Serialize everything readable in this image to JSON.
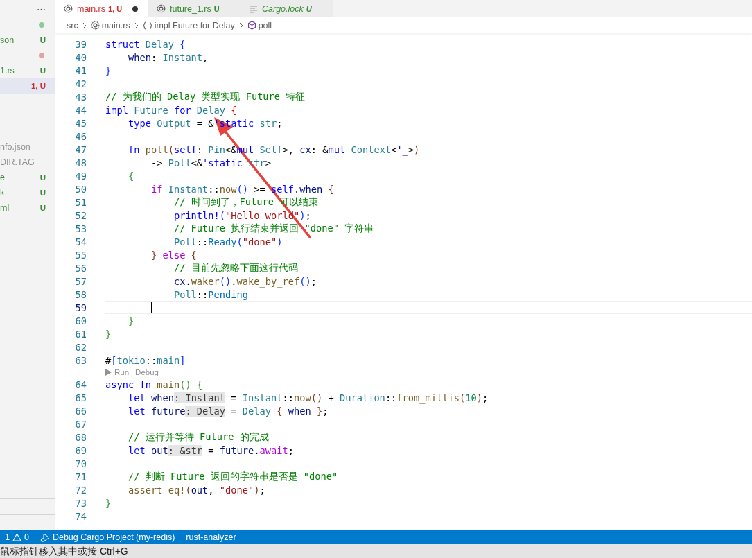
{
  "sidebar": {
    "menu": "···",
    "groups": [
      [
        {
          "kind": "dot",
          "color": "#8fc89a",
          "selected": false
        },
        {
          "kind": "file",
          "label": "son",
          "badge": "U",
          "color": "#388a34",
          "selected": false
        },
        {
          "kind": "dot",
          "color": "#e3a3a3",
          "selected": false
        },
        {
          "kind": "file",
          "label": "1.rs",
          "badge": "U",
          "color": "#388a34",
          "selected": false
        },
        {
          "kind": "file",
          "badge": "1, U",
          "color": "#c72e2e",
          "selected": true
        }
      ],
      [
        {
          "kind": "file",
          "label": "nfo.json",
          "color": "#8e8e90",
          "selected": false
        },
        {
          "kind": "file",
          "label": "DIR.TAG",
          "color": "#8e8e90",
          "selected": false
        },
        {
          "kind": "file",
          "label": "e",
          "badge": "U",
          "color": "#388a34",
          "selected": false
        },
        {
          "kind": "file",
          "label": "k",
          "badge": "U",
          "color": "#388a34",
          "selected": false
        },
        {
          "kind": "file",
          "label": "ml",
          "badge": "U",
          "color": "#388a34",
          "selected": false
        }
      ]
    ]
  },
  "tabs": [
    {
      "kind": "source",
      "label": "main.rs",
      "badge": "1, U",
      "color": "#c72e2e",
      "selected": true,
      "modified": true,
      "preview": false
    },
    {
      "kind": "source",
      "label": "future_1.rs",
      "badge": "U",
      "color": "#388a34",
      "selected": false,
      "modified": false,
      "preview": false
    },
    {
      "kind": "lock",
      "label": "Cargo.lock",
      "badge": "U",
      "color": "#388a34",
      "selected": false,
      "modified": false,
      "preview": true
    }
  ],
  "breadcrumb": [
    {
      "kind": "folder",
      "label": "src"
    },
    {
      "kind": "file",
      "label": "main.rs"
    },
    {
      "kind": "module",
      "label": "impl Future for Delay"
    },
    {
      "kind": "method",
      "label": "poll"
    }
  ],
  "editor": {
    "lines": [
      {
        "kind": "code",
        "number": "39",
        "current": false,
        "tokens": [
          {
            "text": "struct ",
            "kind": "kw"
          },
          {
            "text": "Delay ",
            "kind": "type"
          },
          {
            "text": "{",
            "kind": "b1"
          }
        ]
      },
      {
        "kind": "code",
        "number": "40",
        "current": false,
        "tokens": [
          {
            "text": "    when",
            "kind": "var"
          },
          {
            "text": ": ",
            "kind": "plain"
          },
          {
            "text": "Instant",
            "kind": "type"
          },
          {
            "text": ",",
            "kind": "plain"
          }
        ]
      },
      {
        "kind": "code",
        "number": "41",
        "current": false,
        "tokens": [
          {
            "text": "}",
            "kind": "b1"
          }
        ]
      },
      {
        "kind": "code",
        "number": "42",
        "current": false
      },
      {
        "kind": "code",
        "number": "43",
        "current": false,
        "tokens": [
          {
            "text": "// 为我们的 Delay 类型实现 Future 特征",
            "kind": "cmt"
          }
        ]
      },
      {
        "kind": "code",
        "number": "44",
        "current": false,
        "tokens": [
          {
            "text": "impl ",
            "kind": "kw"
          },
          {
            "text": "Future ",
            "kind": "type"
          },
          {
            "text": "for ",
            "kind": "kw"
          },
          {
            "text": "Delay ",
            "kind": "type"
          },
          {
            "text": "{",
            "kind": "err"
          }
        ]
      },
      {
        "kind": "code",
        "number": "45",
        "current": false,
        "tokens": [
          {
            "text": "    type ",
            "kind": "kw"
          },
          {
            "text": "Output",
            "kind": "type"
          },
          {
            "text": " = &",
            "kind": "plain"
          },
          {
            "text": "'static ",
            "kind": "kw"
          },
          {
            "text": "str",
            "kind": "type"
          },
          {
            "text": ";",
            "kind": "plain"
          }
        ]
      },
      {
        "kind": "code",
        "number": "46",
        "current": false
      },
      {
        "kind": "code",
        "number": "47",
        "current": false,
        "tokens": [
          {
            "text": "    fn ",
            "kind": "kw"
          },
          {
            "text": "poll",
            "kind": "fn"
          },
          {
            "text": "(",
            "kind": "b3"
          },
          {
            "text": "self",
            "kind": "kw"
          },
          {
            "text": ": ",
            "kind": "plain"
          },
          {
            "text": "Pin",
            "kind": "type"
          },
          {
            "text": "<&",
            "kind": "plain"
          },
          {
            "text": "mut ",
            "kind": "kw"
          },
          {
            "text": "Self",
            "kind": "type"
          },
          {
            "text": ">, ",
            "kind": "plain"
          },
          {
            "text": "cx",
            "kind": "var"
          },
          {
            "text": ": &",
            "kind": "plain"
          },
          {
            "text": "mut ",
            "kind": "kw"
          },
          {
            "text": "Context",
            "kind": "type"
          },
          {
            "text": "<",
            "kind": "plain"
          },
          {
            "text": "'_",
            "kind": "kw"
          },
          {
            "text": ">",
            "kind": "plain"
          },
          {
            "text": ")",
            "kind": "b3"
          }
        ]
      },
      {
        "kind": "code",
        "number": "48",
        "current": false,
        "tokens": [
          {
            "text": "        -> ",
            "kind": "plain"
          },
          {
            "text": "Poll",
            "kind": "type"
          },
          {
            "text": "<&",
            "kind": "plain"
          },
          {
            "text": "'static ",
            "kind": "kw"
          },
          {
            "text": "str",
            "kind": "type"
          },
          {
            "text": ">",
            "kind": "plain"
          }
        ]
      },
      {
        "kind": "code",
        "number": "49",
        "current": false,
        "tokens": [
          {
            "text": "    {",
            "kind": "b2"
          }
        ]
      },
      {
        "kind": "code",
        "number": "50",
        "current": false,
        "tokens": [
          {
            "text": "        if ",
            "kind": "ctl"
          },
          {
            "text": "Instant",
            "kind": "type"
          },
          {
            "text": "::",
            "kind": "plain"
          },
          {
            "text": "now",
            "kind": "fn"
          },
          {
            "text": "()",
            "kind": "b1"
          },
          {
            "text": " >= ",
            "kind": "plain"
          },
          {
            "text": "self",
            "kind": "kw"
          },
          {
            "text": ".",
            "kind": "plain"
          },
          {
            "text": "when ",
            "kind": "var"
          },
          {
            "text": "{",
            "kind": "b3"
          }
        ]
      },
      {
        "kind": "code",
        "number": "51",
        "current": false,
        "tokens": [
          {
            "text": "            // 时间到了，Future 可以结束",
            "kind": "cmt"
          }
        ]
      },
      {
        "kind": "code",
        "number": "52",
        "current": false,
        "tokens": [
          {
            "text": "            println!",
            "kind": "kw"
          },
          {
            "text": "(",
            "kind": "b1"
          },
          {
            "text": "\"Hello world\"",
            "kind": "str"
          },
          {
            "text": ")",
            "kind": "b1"
          },
          {
            "text": ";",
            "kind": "plain"
          }
        ]
      },
      {
        "kind": "code",
        "number": "53",
        "current": false,
        "tokens": [
          {
            "text": "            // Future 执行结束并返回 \"done\" 字符串",
            "kind": "cmt"
          }
        ]
      },
      {
        "kind": "code",
        "number": "54",
        "current": false,
        "tokens": [
          {
            "text": "            Poll",
            "kind": "type"
          },
          {
            "text": "::",
            "kind": "plain"
          },
          {
            "text": "Ready",
            "kind": "enum"
          },
          {
            "text": "(",
            "kind": "b1"
          },
          {
            "text": "\"done\"",
            "kind": "str"
          },
          {
            "text": ")",
            "kind": "b1"
          }
        ]
      },
      {
        "kind": "code",
        "number": "55",
        "current": false,
        "tokens": [
          {
            "text": "        } ",
            "kind": "b3"
          },
          {
            "text": "else ",
            "kind": "ctl"
          },
          {
            "text": "{",
            "kind": "b3"
          }
        ]
      },
      {
        "kind": "code",
        "number": "56",
        "current": false,
        "tokens": [
          {
            "text": "            // 目前先忽略下面这行代码",
            "kind": "cmt"
          }
        ]
      },
      {
        "kind": "code",
        "number": "57",
        "current": false,
        "tokens": [
          {
            "text": "            cx",
            "kind": "var"
          },
          {
            "text": ".",
            "kind": "plain"
          },
          {
            "text": "waker",
            "kind": "fn"
          },
          {
            "text": "()",
            "kind": "b1"
          },
          {
            "text": ".",
            "kind": "plain"
          },
          {
            "text": "wake_by_ref",
            "kind": "fn"
          },
          {
            "text": "()",
            "kind": "b1"
          },
          {
            "text": ";",
            "kind": "plain"
          }
        ]
      },
      {
        "kind": "code",
        "number": "58",
        "current": false,
        "tokens": [
          {
            "text": "            Poll",
            "kind": "type"
          },
          {
            "text": "::",
            "kind": "plain"
          },
          {
            "text": "Pending",
            "kind": "enum"
          }
        ]
      },
      {
        "kind": "code",
        "number": "59",
        "current": true
      },
      {
        "kind": "code",
        "number": "60",
        "current": false,
        "tokens": [
          {
            "text": "    }",
            "kind": "b2"
          }
        ]
      },
      {
        "kind": "code",
        "number": "61",
        "current": false,
        "tokens": [
          {
            "text": "}",
            "kind": "b2"
          }
        ]
      },
      {
        "kind": "code",
        "number": "62",
        "current": false
      },
      {
        "kind": "code",
        "number": "63",
        "current": false,
        "tokens": [
          {
            "text": "#",
            "kind": "plain"
          },
          {
            "text": "[",
            "kind": "b1"
          },
          {
            "text": "tokio",
            "kind": "attr"
          },
          {
            "text": "::",
            "kind": "plain"
          },
          {
            "text": "main",
            "kind": "attr"
          },
          {
            "text": "]",
            "kind": "b1"
          }
        ]
      },
      {
        "kind": "lens",
        "links": [
          "Run",
          "Debug"
        ]
      },
      {
        "kind": "code",
        "number": "64",
        "current": false,
        "tokens": [
          {
            "text": "async ",
            "kind": "kw"
          },
          {
            "text": "fn ",
            "kind": "kw"
          },
          {
            "text": "main",
            "kind": "fn"
          },
          {
            "text": "() {",
            "kind": "b2"
          }
        ]
      },
      {
        "kind": "code",
        "number": "65",
        "current": false,
        "tokens": [
          {
            "text": "    let ",
            "kind": "kw"
          },
          {
            "text": "when",
            "kind": "var"
          },
          {
            "text": ": Instant",
            "kind": "hint"
          },
          {
            "text": " = ",
            "kind": "plain"
          },
          {
            "text": "Instant",
            "kind": "type"
          },
          {
            "text": "::",
            "kind": "plain"
          },
          {
            "text": "now",
            "kind": "fn"
          },
          {
            "text": "()",
            "kind": "b3"
          },
          {
            "text": " + ",
            "kind": "plain"
          },
          {
            "text": "Duration",
            "kind": "type"
          },
          {
            "text": "::",
            "kind": "plain"
          },
          {
            "text": "from_millis",
            "kind": "fn"
          },
          {
            "text": "(",
            "kind": "b3"
          },
          {
            "text": "10",
            "kind": "num"
          },
          {
            "text": ")",
            "kind": "b3"
          },
          {
            "text": ";",
            "kind": "plain"
          }
        ]
      },
      {
        "kind": "code",
        "number": "66",
        "current": false,
        "tokens": [
          {
            "text": "    let ",
            "kind": "kw"
          },
          {
            "text": "future",
            "kind": "var"
          },
          {
            "text": ": Delay",
            "kind": "hint"
          },
          {
            "text": " = ",
            "kind": "plain"
          },
          {
            "text": "Delay ",
            "kind": "type"
          },
          {
            "text": "{ ",
            "kind": "b3"
          },
          {
            "text": "when ",
            "kind": "var"
          },
          {
            "text": "}",
            "kind": "b3"
          },
          {
            "text": ";",
            "kind": "plain"
          }
        ]
      },
      {
        "kind": "code",
        "number": "67",
        "current": false
      },
      {
        "kind": "code",
        "number": "68",
        "current": false,
        "tokens": [
          {
            "text": "    // 运行并等待 Future 的完成",
            "kind": "cmt"
          }
        ]
      },
      {
        "kind": "code",
        "number": "69",
        "current": false,
        "tokens": [
          {
            "text": "    let ",
            "kind": "kw"
          },
          {
            "text": "out",
            "kind": "var"
          },
          {
            "text": ": &str",
            "kind": "hint"
          },
          {
            "text": " = ",
            "kind": "plain"
          },
          {
            "text": "future",
            "kind": "var"
          },
          {
            "text": ".",
            "kind": "plain"
          },
          {
            "text": "await",
            "kind": "ctl"
          },
          {
            "text": ";",
            "kind": "plain"
          }
        ]
      },
      {
        "kind": "code",
        "number": "70",
        "current": false
      },
      {
        "kind": "code",
        "number": "71",
        "current": false,
        "tokens": [
          {
            "text": "    // 判断 Future 返回的字符串是否是 \"done\"",
            "kind": "cmt"
          }
        ]
      },
      {
        "kind": "code",
        "number": "72",
        "current": false,
        "tokens": [
          {
            "text": "    assert_eq!",
            "kind": "fn"
          },
          {
            "text": "(",
            "kind": "b3"
          },
          {
            "text": "out",
            "kind": "var"
          },
          {
            "text": ", ",
            "kind": "plain"
          },
          {
            "text": "\"done\"",
            "kind": "str"
          },
          {
            "text": ")",
            "kind": "b3"
          },
          {
            "text": ";",
            "kind": "plain"
          }
        ]
      },
      {
        "kind": "code",
        "number": "73",
        "current": false,
        "tokens": [
          {
            "text": "}",
            "kind": "b2"
          }
        ]
      },
      {
        "kind": "code",
        "number": "74",
        "current": false
      }
    ]
  },
  "status_bar": {
    "errors": "1",
    "warnings": "0",
    "items": [
      {
        "kind": "debug",
        "label": "Debug Cargo Project (my-redis)"
      },
      {
        "kind": "plain",
        "label": "rust-analyzer"
      }
    ]
  },
  "hint_bar": {
    "text": "鼠标指针移入其中或按 Ctrl+G"
  }
}
